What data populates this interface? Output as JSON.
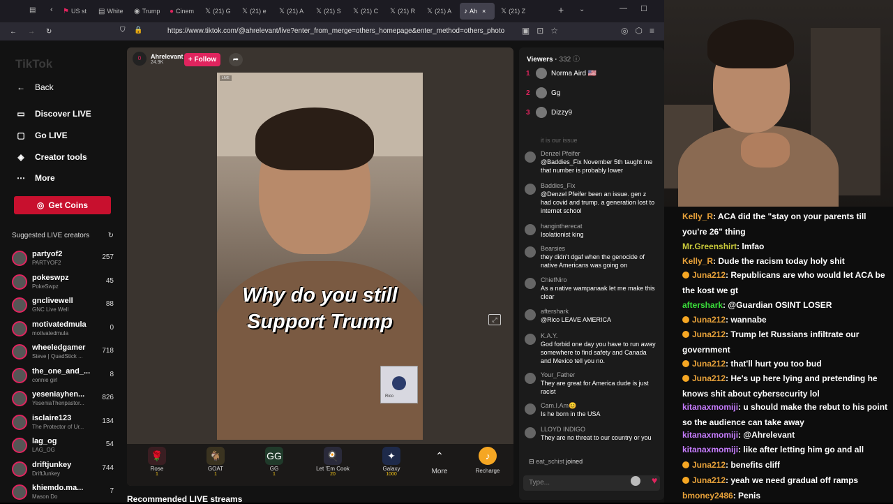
{
  "browser": {
    "tabs": [
      {
        "label": "US st",
        "icon": "flag-icon"
      },
      {
        "label": "White",
        "icon": "doc-icon"
      },
      {
        "label": "Trump",
        "icon": "news-icon"
      },
      {
        "label": "Cinem",
        "icon": "film-icon"
      },
      {
        "label": "(21) G",
        "icon": "x-icon"
      },
      {
        "label": "(21) e",
        "icon": "x-icon"
      },
      {
        "label": "(21) A",
        "icon": "x-icon"
      },
      {
        "label": "(21) S",
        "icon": "x-icon"
      },
      {
        "label": "(21) C",
        "icon": "x-icon"
      },
      {
        "label": "(21) R",
        "icon": "x-icon"
      },
      {
        "label": "(21) A",
        "icon": "x-icon"
      },
      {
        "label": "Ah",
        "icon": "tiktok-icon",
        "active": true
      },
      {
        "label": "(21) Z",
        "icon": "x-icon"
      }
    ],
    "url": "https://www.tiktok.com/@ahrelevant/live?enter_from_merge=others_homepage&enter_method=others_photo"
  },
  "sidebar": {
    "logo": "TikTok",
    "nav": [
      {
        "label": "Back",
        "icon": "arrow-left-icon"
      },
      {
        "label": "Discover LIVE",
        "icon": "tv-icon"
      },
      {
        "label": "Go LIVE",
        "icon": "camera-icon"
      },
      {
        "label": "Creator tools",
        "icon": "bulb-icon"
      },
      {
        "label": "More",
        "icon": "ellipsis-icon"
      }
    ],
    "coins_button": "Get Coins",
    "suggested_heading": "Suggested LIVE creators",
    "creators": [
      {
        "name": "partyof2",
        "sub": "PARTYOF2",
        "count": "257",
        "verified": true
      },
      {
        "name": "pokeswpz",
        "sub": "PokeSwpz",
        "count": "45"
      },
      {
        "name": "gnclivewell",
        "sub": "GNC Live Well",
        "count": "88",
        "verified": true
      },
      {
        "name": "motivatedmula",
        "sub": "motivatedmula",
        "count": "0"
      },
      {
        "name": "wheeledgamer",
        "sub": "Steve | QuadStick ...",
        "count": "718"
      },
      {
        "name": "the_one_and_...",
        "sub": "connie girl",
        "count": "8"
      },
      {
        "name": "yesenia​yhen...",
        "sub": "YeseniaThenpastor...",
        "count": "826"
      },
      {
        "name": "isclaire123",
        "sub": "The Protector of Ur...",
        "count": "134"
      },
      {
        "name": "lag_og",
        "sub": "LAG_OG",
        "count": "54"
      },
      {
        "name": "driftjunkey",
        "sub": "DriftJunkey",
        "count": "744"
      },
      {
        "name": "khiemdo.ma...",
        "sub": "Mason Do",
        "count": "7"
      }
    ]
  },
  "live": {
    "host_name": "Ahrelevant",
    "host_likes": "24.9K",
    "host_badge": "0",
    "follow_label": "+ Follow",
    "caption_line1": "Why do you  still",
    "caption_line2": "Support Trump",
    "pip_label": "Rico",
    "gifts": [
      {
        "name": "Rose",
        "price": "1",
        "icon": "rose-icon"
      },
      {
        "name": "GOAT",
        "price": "1",
        "icon": "goat-icon"
      },
      {
        "name": "GG",
        "price": "1",
        "icon": "gg-icon"
      },
      {
        "name": "Let 'Em Cook",
        "price": "20",
        "icon": "cook-icon"
      },
      {
        "name": "Galaxy",
        "price": "1000",
        "icon": "galaxy-icon"
      },
      {
        "name": "More",
        "price": "",
        "icon": "chevron-up-icon"
      },
      {
        "name": "Recharge",
        "price": "",
        "icon": "coin-icon"
      }
    ],
    "recommended": "Recommended LIVE streams"
  },
  "chat": {
    "viewers_label": "Viewers",
    "viewers_count": "332",
    "top_viewers": [
      {
        "rank": "1",
        "name": "Norma Aird 🇺🇸"
      },
      {
        "rank": "2",
        "name": "Gg"
      },
      {
        "rank": "3",
        "name": "Dizzy9"
      }
    ],
    "faded_line": "it is our issue",
    "messages": [
      {
        "user": "Denzel Pfeifer",
        "text": "@Baddies_Fix November 5th taught me that number is probably lower"
      },
      {
        "user": "Baddies_Fix",
        "text": "@Denzel Pfeifer been an issue. gen z had covid and trump. a generation lost to internet school"
      },
      {
        "user": "hanginthere​cat",
        "text": "Isolationist king"
      },
      {
        "user": "Bearsies",
        "text": "they didn't dgaf when the genocide of native Americans was going on"
      },
      {
        "user": "ChiefNiro",
        "text": "As a native wampanaak let me make this clear"
      },
      {
        "user": "aftershark",
        "text": "@Rico LEAVE AMERICA"
      },
      {
        "user": "K.A.Y.",
        "text": "God forbid one day you have to run away somewhere to find safety and Canada and Mexico tell you no."
      },
      {
        "user": "Your_Father",
        "text": "They are great for America dude is just racist"
      },
      {
        "user": "Cam.I.Am😊",
        "text": "Is he born in the USA"
      },
      {
        "user": "LLOYD INDIGO",
        "text": "They are no threat to our country or you"
      }
    ],
    "joined_user": "eat_schist",
    "joined_text": "joined",
    "input_placeholder": "Type..."
  },
  "stream_chat": [
    {
      "user": "Kelly_R",
      "text": ": ACA did the \"stay on your parents till you're 26\" thing",
      "color": "#e8a23a"
    },
    {
      "user": "Mr.Greenshirt",
      "text": ": lmfao",
      "color": "#c9c93a"
    },
    {
      "user": "Kelly_R",
      "text": ": Dude the racism today holy shit",
      "color": "#e8a23a"
    },
    {
      "user": "Juna212",
      "text": ": Republicans are who would let ACA be the kost we gt",
      "color": "#e8a23a",
      "badge": true
    },
    {
      "user": "aftershark",
      "text": ": @Guardian OSINT LOSER",
      "color": "#3adf3a"
    },
    {
      "user": "Juna212",
      "text": ": wannabe",
      "color": "#e8a23a",
      "badge": true
    },
    {
      "user": "Juna212",
      "text": ": Trump let Russians infiltrate our government",
      "color": "#e8a23a",
      "badge": true
    },
    {
      "user": "Juna212",
      "text": ": that'll hurt you too bud",
      "color": "#e8a23a",
      "badge": true
    },
    {
      "user": "Juna212",
      "text": ": He's up here lying and pretending he knows shit about cybersecurity lol",
      "color": "#e8a23a",
      "badge": true
    },
    {
      "user": "kitanaxmomiji",
      "text": ": u should make the rebut to his point so the audience can take away",
      "color": "#c77dff"
    },
    {
      "user": "kitanaxmomiji",
      "text": ": @Ahrelevant",
      "color": "#c77dff"
    },
    {
      "user": "kitanaxmomiji",
      "text": ": like after letting him go and all",
      "color": "#c77dff"
    },
    {
      "user": "Juna212",
      "text": ": benefits cliff",
      "color": "#e8a23a",
      "badge": true
    },
    {
      "user": "Juna212",
      "text": ": yeah we need gradual off ramps",
      "color": "#e8a23a",
      "badge": true
    },
    {
      "user": "bmoney2486",
      "text": ": Penis",
      "color": "#e8a23a"
    }
  ]
}
